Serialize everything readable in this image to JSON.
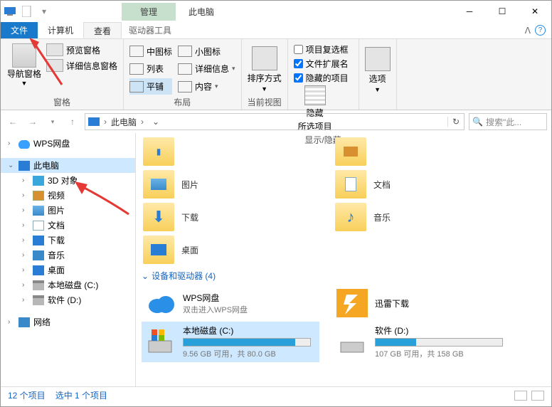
{
  "title": {
    "manage": "管理",
    "window": "此电脑"
  },
  "tabs": {
    "file": "文件",
    "computer": "计算机",
    "view": "查看",
    "drivetools": "驱动器工具"
  },
  "ribbon": {
    "panes": {
      "nav": "导航窗格",
      "preview": "预览窗格",
      "details": "详细信息窗格",
      "label": "窗格"
    },
    "layout": {
      "medium": "中图标",
      "small": "小图标",
      "list": "列表",
      "details": "详细信息",
      "tiles": "平铺",
      "content": "内容",
      "label": "布局"
    },
    "currentview": {
      "sort": "排序方式",
      "label": "当前视图"
    },
    "showhide": {
      "checkboxes": "项目复选框",
      "extensions": "文件扩展名",
      "hidden": "隐藏的项目",
      "hide": "隐藏",
      "selected": "所选项目",
      "label": "显示/隐藏"
    },
    "options": {
      "options": "选项"
    }
  },
  "breadcrumb": {
    "root": "此电脑"
  },
  "search": {
    "placeholder": "搜索\"此..."
  },
  "tree": {
    "wps": "WPS网盘",
    "thispc": "此电脑",
    "items": [
      {
        "label": "3D 对象"
      },
      {
        "label": "视频"
      },
      {
        "label": "图片"
      },
      {
        "label": "文档"
      },
      {
        "label": "下载"
      },
      {
        "label": "音乐"
      },
      {
        "label": "桌面"
      },
      {
        "label": "本地磁盘 (C:)"
      },
      {
        "label": "软件 (D:)"
      }
    ],
    "network": "网络"
  },
  "folders": [
    {
      "name": "图片"
    },
    {
      "name": "文档"
    },
    {
      "name": "下载"
    },
    {
      "name": "音乐"
    },
    {
      "name": "桌面"
    }
  ],
  "devices_header": "设备和驱动器 (4)",
  "devices": {
    "wps": {
      "name": "WPS网盘",
      "sub": "双击进入WPS网盘"
    },
    "xunlei": {
      "name": "迅雷下载"
    },
    "c": {
      "name": "本地磁盘 (C:)",
      "free": "9.56 GB 可用，共 80.0 GB",
      "pct": 88
    },
    "d": {
      "name": "软件 (D:)",
      "free": "107 GB 可用，共 158 GB",
      "pct": 32
    }
  },
  "status": {
    "count": "12 个项目",
    "sel": "选中 1 个项目"
  }
}
